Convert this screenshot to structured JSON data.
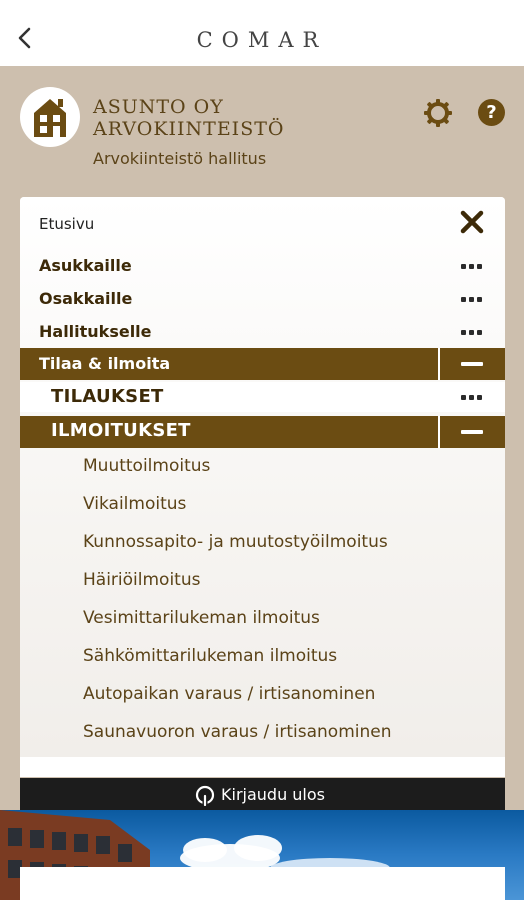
{
  "topbar": {
    "brand": "COMAR"
  },
  "header": {
    "company_line1": "ASUNTO OY",
    "company_line2": "ARVOKIINTEISTÖ",
    "subtitle": "Arvokiinteistö hallitus"
  },
  "menu": {
    "home": "Etusivu",
    "items": [
      {
        "label": "Asukkaille"
      },
      {
        "label": "Osakkaille"
      },
      {
        "label": "Hallitukselle"
      },
      {
        "label": "Tilaa & ilmoita"
      }
    ],
    "sub": [
      {
        "label": "TILAUKSET"
      },
      {
        "label": "ILMOITUKSET"
      }
    ],
    "notices": [
      "Muuttoilmoitus",
      "Vikailmoitus",
      "Kunnossapito- ja muutostyöilmoitus",
      "Häiriöilmoitus",
      "Vesimittarilukeman ilmoitus",
      "Sähkömittarilukeman ilmoitus",
      "Autopaikan varaus / irtisanominen",
      "Saunavuoron varaus / irtisanominen"
    ]
  },
  "logout": {
    "label": "Kirjaudu ulos"
  },
  "colors": {
    "accent": "#6b4c12",
    "band": "#cdbfae",
    "logout_bg": "#1c1c1c"
  }
}
